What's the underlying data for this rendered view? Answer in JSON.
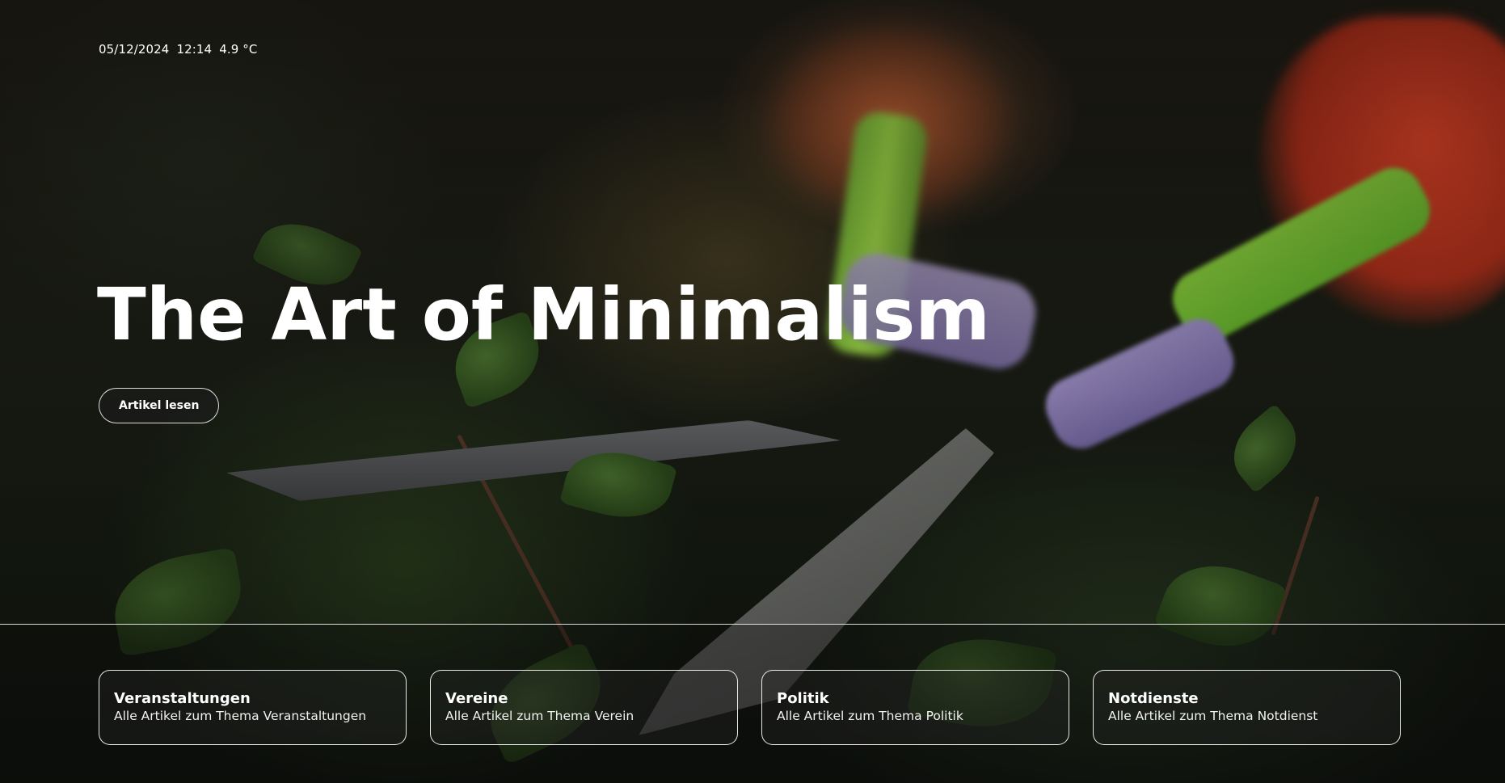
{
  "status_bar": {
    "date": "05/12/2024",
    "time": "12:14",
    "temperature": "4.9 °C"
  },
  "hero": {
    "title": "The Art of Minimalism",
    "read_button_label": "Artikel lesen",
    "background_image": "blurred photo of hedge trimming shears with green handles and orange gloves"
  },
  "categories": [
    {
      "title": "Veranstaltungen",
      "subtitle": "Alle Artikel zum Thema Veranstaltungen"
    },
    {
      "title": "Vereine",
      "subtitle": "Alle Artikel zum Thema Verein"
    },
    {
      "title": "Politik",
      "subtitle": "Alle Artikel zum Thema Politik"
    },
    {
      "title": "Notdienste",
      "subtitle": "Alle Artikel zum Thema Notdienst"
    }
  ],
  "colors": {
    "text": "#ffffff",
    "border": "#ffffff",
    "accent_green": "#8fd73f",
    "accent_orange": "#e8472a"
  }
}
